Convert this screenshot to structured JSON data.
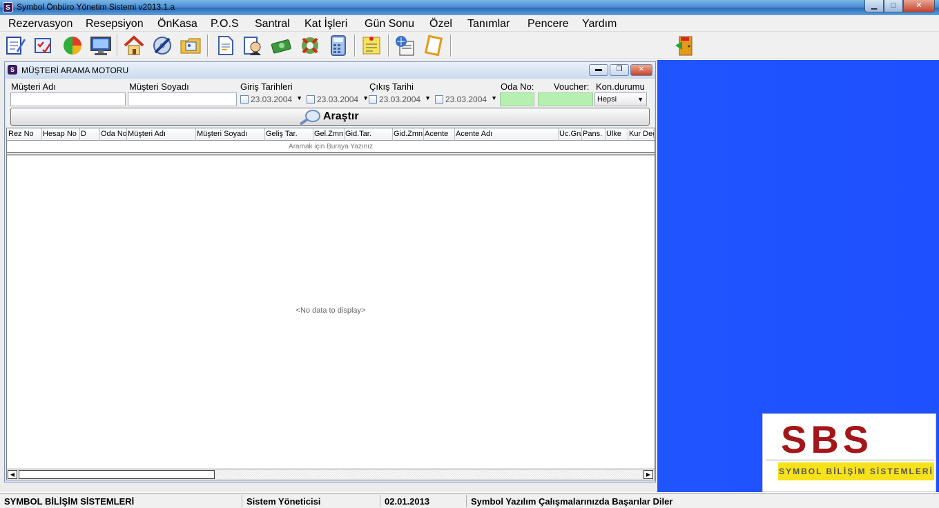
{
  "app": {
    "title": "Symbol Önbüro Yönetim Sistemi v2013.1.a",
    "icon_letter": "S"
  },
  "window_buttons": {
    "minimize": "▁",
    "maximize": "□",
    "close": "✕"
  },
  "menu": [
    "Rezervasyon",
    "Resepsiyon",
    "ÖnKasa",
    "P.O.S",
    "Santral",
    "Kat İşleri",
    "Gün Sonu",
    "Özel",
    "Tanımlar",
    "Pencere",
    "Yardım"
  ],
  "toolbar": {
    "icons": [
      "reservation-notepad-icon",
      "checklist-icon",
      "pie-chart-icon",
      "monitor-icon",
      "home-icon",
      "cd-tools-icon",
      "folder-card-icon",
      "document-icon",
      "customer-search-icon",
      "money-icon",
      "rescue-ring-icon",
      "calculator-icon",
      "sticky-note-icon",
      "phone-book-icon",
      "notepad-icon",
      "exit-door-icon"
    ]
  },
  "child_window": {
    "title": "MÜŞTERİ ARAMA MOTORU",
    "icon_letter": "S",
    "buttons": {
      "minimize": "▬",
      "restore": "❐",
      "close": "✕"
    }
  },
  "search_form": {
    "labels": {
      "first_name": "Müşteri Adı",
      "last_name": "Müşteri Soyadı",
      "checkin_dates": "Giriş Tarihleri",
      "checkout_date": "Çıkış Tarihi",
      "room_no": "Oda No:",
      "voucher": "Voucher:",
      "status": "Kon.durumu"
    },
    "first_name_value": "",
    "last_name_value": "",
    "checkin_from": "23.03.2004",
    "checkin_to": "23.03.2004",
    "checkout_from": "23.03.2004",
    "checkout_to": "23.03.2004",
    "room_no_value": "",
    "voucher_value": "",
    "status_value": "Hepsi",
    "search_button": "Araştır"
  },
  "grid": {
    "columns": [
      "Rez No",
      "Hesap No",
      "D",
      "Oda No",
      "Müşteri Adı",
      "Müşteri Soyadı",
      "Geliş Tar.",
      "Gel.Zmn",
      "Gid.Tar.",
      "Gid.Zmn",
      "Acente",
      "Acente Adı",
      "Üc.Gru",
      "Pans.",
      "Ülke",
      "Kur Değ"
    ],
    "filter_hint": "Aramak için Buraya Yazınız",
    "empty_text": "<No data to display>"
  },
  "scrollbar": {
    "left_arrow": "◀",
    "right_arrow": "▶"
  },
  "logo": {
    "brand": "SBS",
    "tagline": "SYMBOL BİLİŞİM SİSTEMLERİ"
  },
  "status_bar": {
    "company": "SYMBOL BİLİŞİM SİSTEMLERİ",
    "user": "Sistem Yöneticisi",
    "date": "02.01.2013",
    "message": "Symbol Yazılım Çalışmalarınızda Başarılar Diler"
  }
}
